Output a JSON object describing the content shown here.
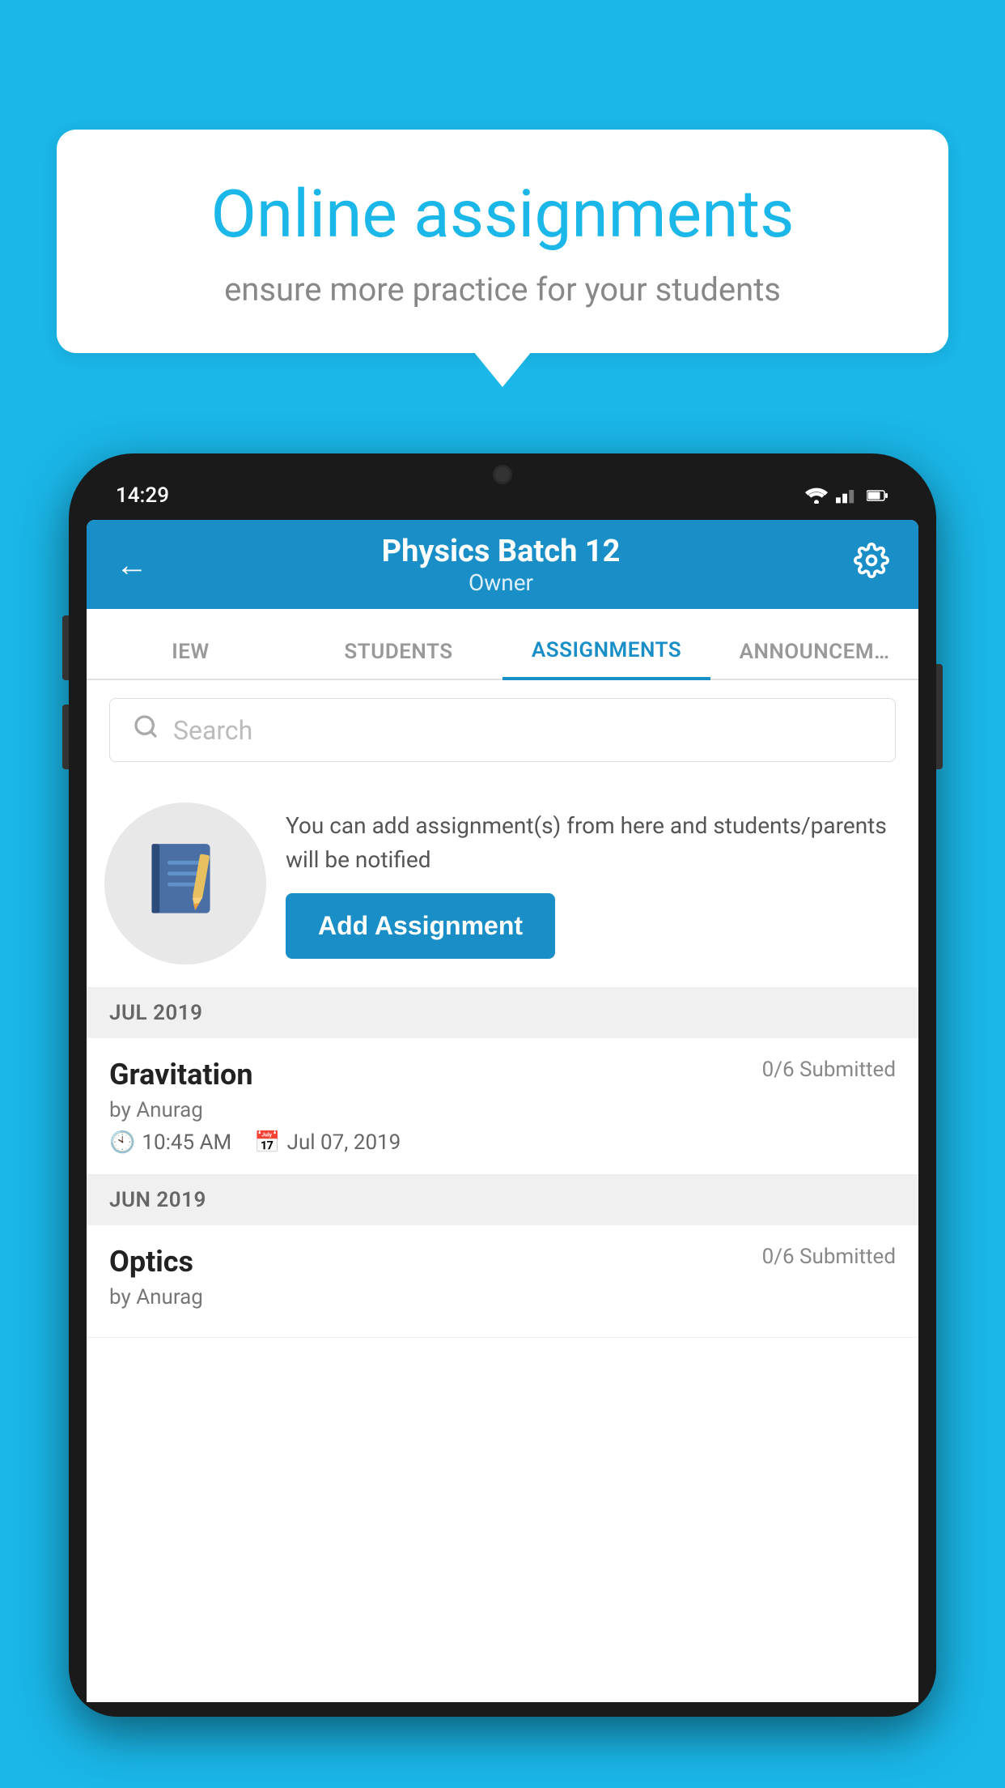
{
  "background_color": "#1ab7e8",
  "bubble": {
    "title": "Online assignments",
    "subtitle": "ensure more practice for your students"
  },
  "phone": {
    "status_bar": {
      "time": "14:29"
    },
    "header": {
      "title": "Physics Batch 12",
      "subtitle": "Owner",
      "back_label": "←",
      "settings_label": "⚙"
    },
    "tabs": [
      {
        "label": "IEW",
        "active": false
      },
      {
        "label": "STUDENTS",
        "active": false
      },
      {
        "label": "ASSIGNMENTS",
        "active": true
      },
      {
        "label": "ANNOUNCEM…",
        "active": false
      }
    ],
    "search": {
      "placeholder": "Search"
    },
    "promo": {
      "description": "You can add assignment(s) from here and students/parents will be notified",
      "button_label": "Add Assignment"
    },
    "sections": [
      {
        "month": "JUL 2019",
        "assignments": [
          {
            "name": "Gravitation",
            "submitted": "0/6 Submitted",
            "by": "by Anurag",
            "time": "10:45 AM",
            "date": "Jul 07, 2019"
          }
        ]
      },
      {
        "month": "JUN 2019",
        "assignments": [
          {
            "name": "Optics",
            "submitted": "0/6 Submitted",
            "by": "by Anurag",
            "time": "",
            "date": ""
          }
        ]
      }
    ]
  }
}
